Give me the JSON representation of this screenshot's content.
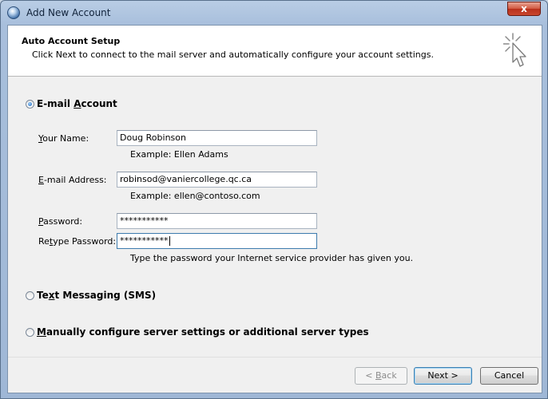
{
  "window": {
    "title": "Add New Account",
    "close_label": "x"
  },
  "header": {
    "title": "Auto Account Setup",
    "description": "Click Next to connect to the mail server and automatically configure your account settings."
  },
  "options": {
    "email": {
      "label_pre": "E-mail ",
      "label_accel": "A",
      "label_post": "ccount",
      "selected": true
    },
    "sms": {
      "label_pre": "Te",
      "label_accel": "x",
      "label_post": "t Messaging (SMS)",
      "selected": false
    },
    "manual": {
      "label_pre": "",
      "label_accel": "M",
      "label_post": "anually configure server settings or additional server types",
      "selected": false
    }
  },
  "form": {
    "name": {
      "label_pre": "",
      "label_accel": "Y",
      "label_post": "our Name:",
      "value": "Doug Robinson",
      "hint": "Example: Ellen Adams"
    },
    "email": {
      "label_pre": "",
      "label_accel": "E",
      "label_post": "-mail Address:",
      "value": "robinsod@vaniercollege.qc.ca",
      "hint": "Example: ellen@contoso.com"
    },
    "password": {
      "label_pre": "",
      "label_accel": "P",
      "label_post": "assword:",
      "value": "***********"
    },
    "retype": {
      "label_pre": "Re",
      "label_accel": "t",
      "label_post": "ype Password:",
      "value": "***********",
      "hint": "Type the password your Internet service provider has given you."
    }
  },
  "buttons": {
    "back": {
      "label_pre": "< ",
      "label_accel": "B",
      "label_post": "ack",
      "enabled": false
    },
    "next": {
      "label": "Next >"
    },
    "cancel": {
      "label": "Cancel"
    }
  },
  "colors": {
    "title_bar": "#b9cde5",
    "close_button": "#c9482f",
    "dialog_bg": "#f0f0f0",
    "radio_dot": "#1a5fb4"
  }
}
